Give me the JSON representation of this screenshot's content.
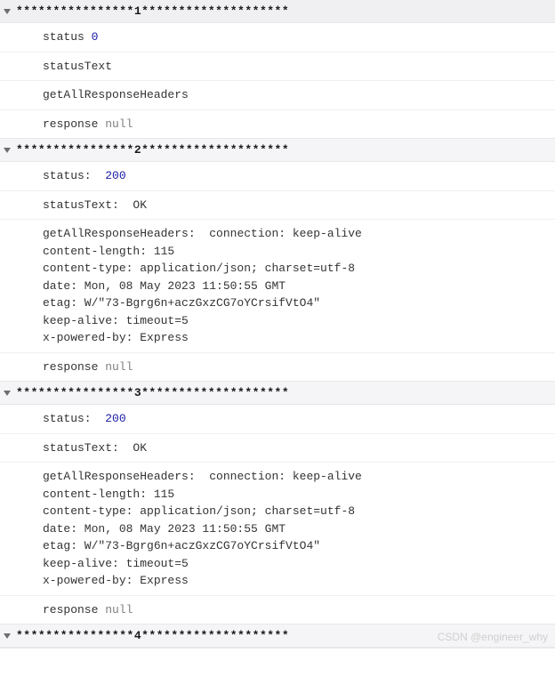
{
  "groups": [
    {
      "header": "****************1********************",
      "lines": [
        {
          "key": "status ",
          "value": "0",
          "valueType": "num"
        },
        {
          "key": "statusText",
          "value": "",
          "valueType": "text"
        },
        {
          "key": "getAllResponseHeaders",
          "value": "",
          "valueType": "text"
        },
        {
          "key": "response ",
          "value": "null",
          "valueType": "null"
        }
      ]
    },
    {
      "header": "****************2********************",
      "lines": [
        {
          "key": "status:  ",
          "value": "200",
          "valueType": "num"
        },
        {
          "key": "statusText:  ",
          "value": "OK",
          "valueType": "text"
        },
        {
          "key": "getAllResponseHeaders:  ",
          "value": "connection: keep-alive\ncontent-length: 115\ncontent-type: application/json; charset=utf-8\ndate: Mon, 08 May 2023 11:50:55 GMT\netag: W/\"73-Bgrg6n+aczGxzCG7oYCrsifVtO4\"\nkeep-alive: timeout=5\nx-powered-by: Express\n",
          "valueType": "multi"
        },
        {
          "key": "response ",
          "value": "null",
          "valueType": "null"
        }
      ]
    },
    {
      "header": "****************3********************",
      "lines": [
        {
          "key": "status:  ",
          "value": "200",
          "valueType": "num"
        },
        {
          "key": "statusText:  ",
          "value": "OK",
          "valueType": "text"
        },
        {
          "key": "getAllResponseHeaders:  ",
          "value": "connection: keep-alive\ncontent-length: 115\ncontent-type: application/json; charset=utf-8\ndate: Mon, 08 May 2023 11:50:55 GMT\netag: W/\"73-Bgrg6n+aczGxzCG7oYCrsifVtO4\"\nkeep-alive: timeout=5\nx-powered-by: Express\n",
          "valueType": "multi"
        },
        {
          "key": "response ",
          "value": "null",
          "valueType": "null"
        }
      ]
    },
    {
      "header": "****************4********************",
      "lines": []
    }
  ],
  "watermark": "CSDN @engineer_why"
}
